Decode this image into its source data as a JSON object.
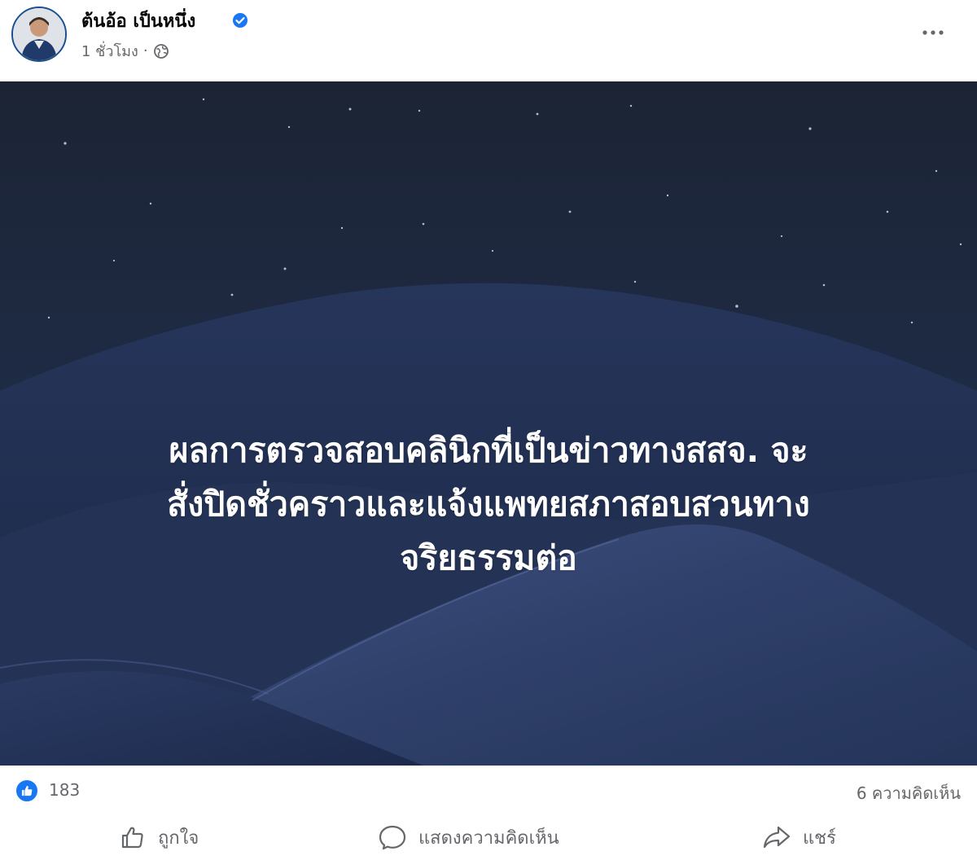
{
  "post": {
    "author": {
      "name": "ต้นอ้อ เป็นหนึ่ง",
      "verified_icon": "verified-badge-icon"
    },
    "timestamp": "1 ชั่วโมง",
    "separator": "·",
    "audience_icon": "globe-icon",
    "more_icon": "more-options-icon",
    "image": {
      "text_lines": [
        "ผลการตรวจสอบคลินิกที่เป็นข่าวทางสสจ. จะ",
        "สั่งปิดชั่วคราวและแจ้งแพทยสภาสอบสวนทาง",
        "จริยธรรมต่อ"
      ]
    },
    "reactions": {
      "like_icon": "like-reaction-icon",
      "count": "183",
      "comments": "6 ความคิดเห็น"
    },
    "actions": {
      "like": "ถูกใจ",
      "comment": "แสดงความคิดเห็น",
      "share": "แชร์"
    },
    "colors": {
      "accent": "#1877f2",
      "secondary_text": "#65676b",
      "image_text": "#ffffff",
      "sky_top": "#1b2333",
      "dune": "#2d3d63"
    }
  }
}
